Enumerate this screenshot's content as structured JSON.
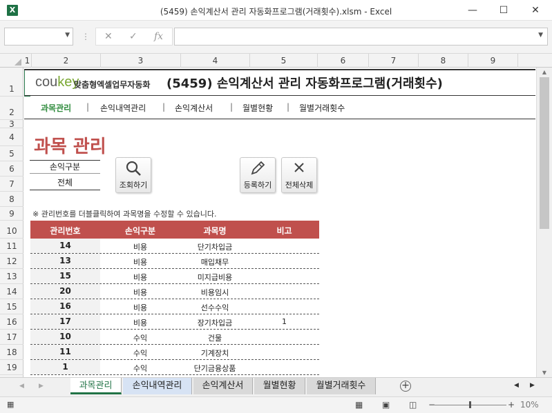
{
  "window": {
    "app_icon": "X",
    "title": "(5459) 손익계산서 관리 자동화프로그램(거래횟수).xlsm - Excel",
    "minimize": "—",
    "maximize": "☐",
    "close": "✕"
  },
  "formula_bar": {
    "name_box": "",
    "cancel_icon": "✕",
    "enter_icon": "✓",
    "fx_label": "fx",
    "content": ""
  },
  "columns": [
    "1",
    "2",
    "3",
    "4",
    "5",
    "6",
    "7",
    "8",
    "9"
  ],
  "rows": [
    "1",
    "2",
    "3",
    "4",
    "5",
    "6",
    "7",
    "8",
    "9",
    "10",
    "11",
    "12",
    "13",
    "14",
    "15",
    "16",
    "17",
    "18",
    "19"
  ],
  "header": {
    "logo_a": "cou",
    "logo_b": "key",
    "logo_sub": "맞춤형엑셀업무자동화",
    "title": "(5459) 손익계산서 관리 자동화프로그램(거래횟수)"
  },
  "nav": {
    "items": [
      "과목관리",
      "손익내역관리",
      "손익계산서",
      "월별현황",
      "월별거래횟수"
    ],
    "separator": "|"
  },
  "section_title": "과목 관리",
  "filter": {
    "label": "손익구분",
    "value": "전체"
  },
  "buttons": {
    "search": "조회하기",
    "register": "등록하기",
    "delete_all": "전체삭제"
  },
  "note": "※ 관리번호를 더블클릭하여 과목명을 수정할 수 있습니다.",
  "table": {
    "headers": [
      "관리번호",
      "손익구분",
      "과목명",
      "비고"
    ],
    "rows": [
      {
        "id": "14",
        "type": "비용",
        "name": "단기차입금",
        "note": ""
      },
      {
        "id": "13",
        "type": "비용",
        "name": "매입채무",
        "note": ""
      },
      {
        "id": "15",
        "type": "비용",
        "name": "미지급비용",
        "note": ""
      },
      {
        "id": "20",
        "type": "비용",
        "name": "비용임시",
        "note": ""
      },
      {
        "id": "16",
        "type": "비용",
        "name": "선수수익",
        "note": ""
      },
      {
        "id": "17",
        "type": "비용",
        "name": "장기차입금",
        "note": "1"
      },
      {
        "id": "10",
        "type": "수익",
        "name": "건물",
        "note": ""
      },
      {
        "id": "11",
        "type": "수익",
        "name": "기계장치",
        "note": ""
      },
      {
        "id": "1",
        "type": "수익",
        "name": "단기금융상품",
        "note": ""
      }
    ]
  },
  "sheet_tabs": [
    "과목관리",
    "손익내역관리",
    "손익계산서",
    "월별현황",
    "월별거래횟수"
  ],
  "status": {
    "zoom": "10%",
    "zoom_minus": "−",
    "zoom_plus": "+"
  },
  "colors": {
    "accent_red": "#c0504d",
    "excel_green": "#217346",
    "nav_active": "#2e8b3c"
  }
}
